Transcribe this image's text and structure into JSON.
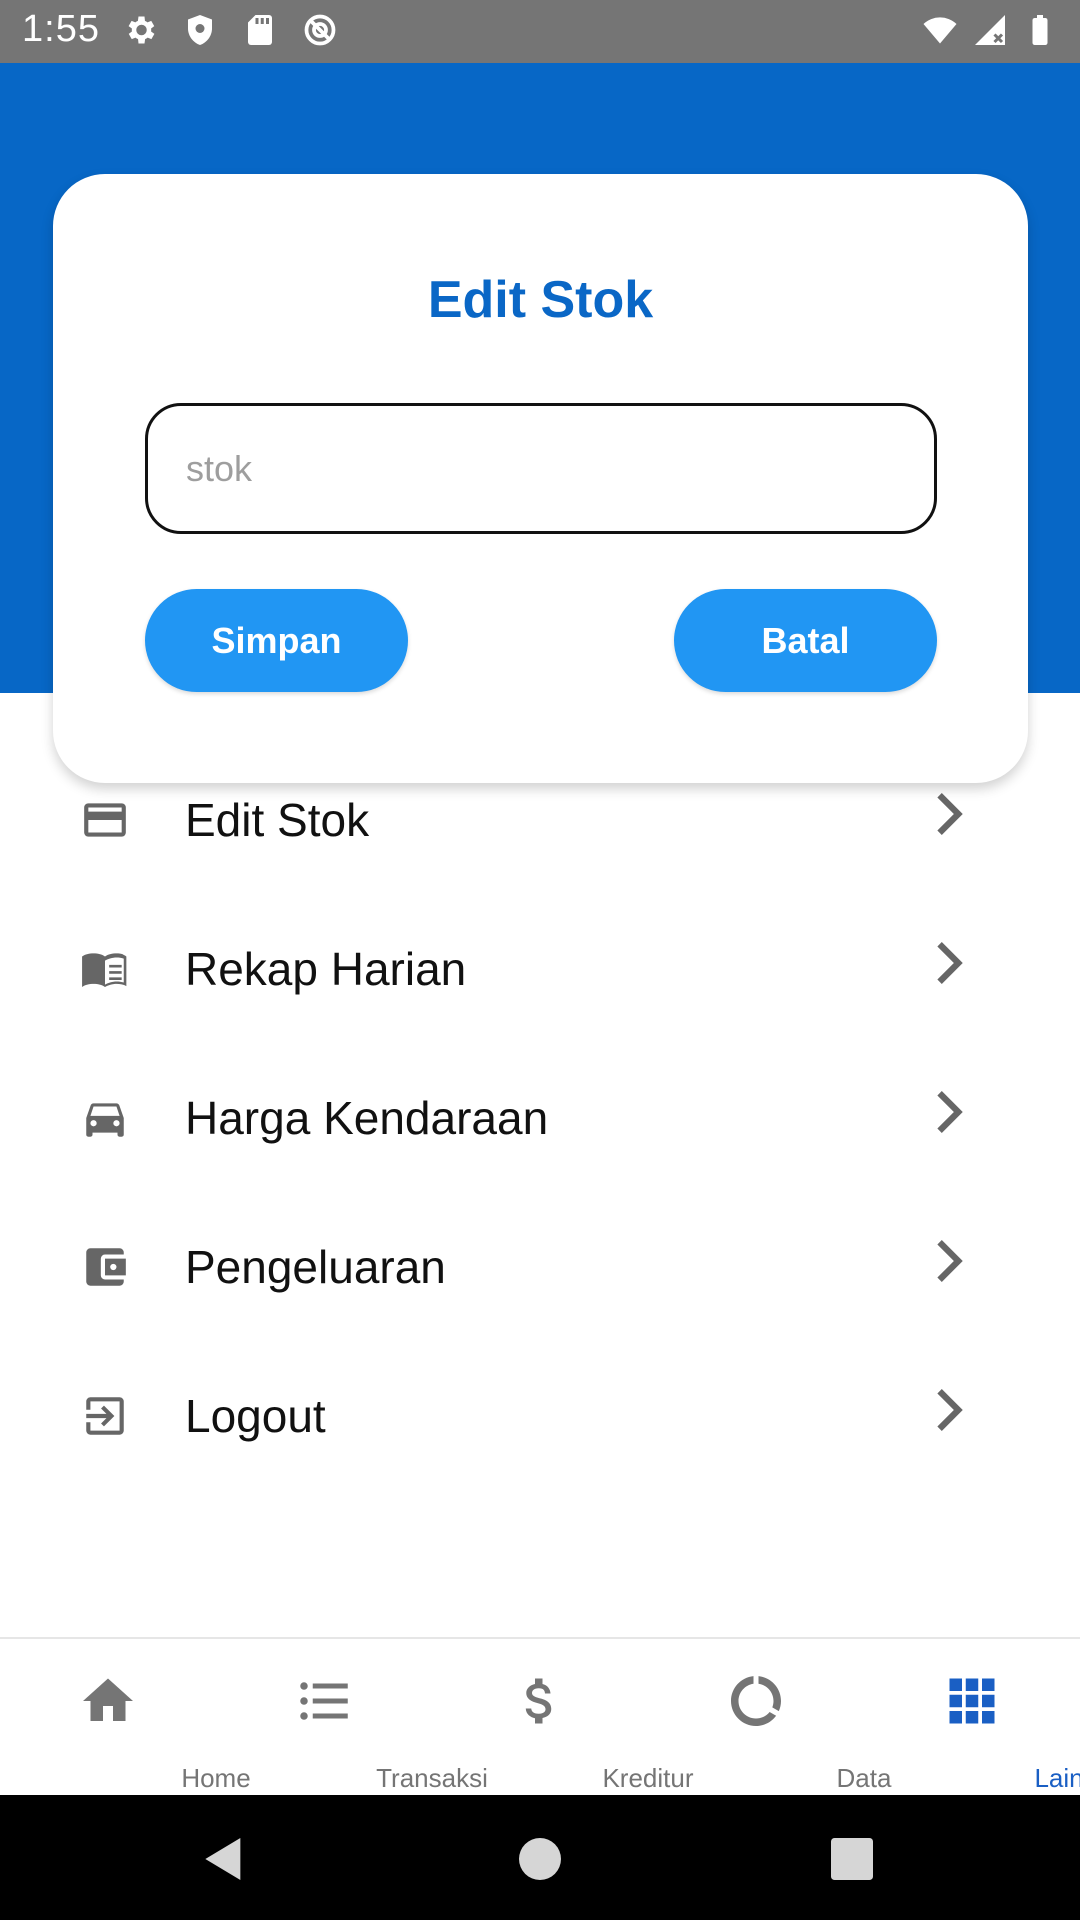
{
  "status_bar": {
    "time": "1:55",
    "left_icons": [
      "gear-icon",
      "shield-icon",
      "sd-card-icon",
      "no-location-icon"
    ],
    "right_icons": [
      "wifi-icon",
      "signal-icon",
      "battery-icon"
    ]
  },
  "colors": {
    "header_blue": "#0767c6",
    "title_blue": "#0a67c6",
    "button_blue": "#2196f3",
    "active_nav": "#1a5fc4"
  },
  "dialog": {
    "title": "Edit Stok",
    "input_placeholder": "stok",
    "input_value": "",
    "save_label": "Simpan",
    "cancel_label": "Batal"
  },
  "menu": {
    "items": [
      {
        "label": "Edit Stok",
        "icon": "credit-card-icon"
      },
      {
        "label": "Rekap Harian",
        "icon": "book-icon"
      },
      {
        "label": "Harga Kendaraan",
        "icon": "car-icon"
      },
      {
        "label": "Pengeluaran",
        "icon": "wallet-icon"
      },
      {
        "label": "Logout",
        "icon": "logout-icon"
      }
    ]
  },
  "bottom_nav": {
    "items": [
      {
        "label": "Home",
        "icon": "home-icon"
      },
      {
        "label": "Transaksi",
        "icon": "list-icon"
      },
      {
        "label": "Kreditur",
        "icon": "dollar-icon"
      },
      {
        "label": "Data",
        "icon": "donut-chart-icon"
      },
      {
        "label": "Lainnya",
        "icon": "grid-icon"
      }
    ],
    "active": "Lainnya"
  }
}
